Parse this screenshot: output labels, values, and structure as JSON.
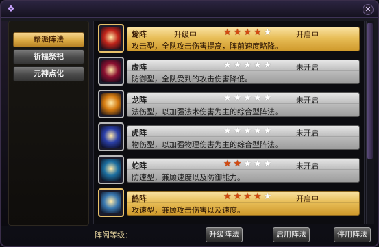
{
  "window": {
    "close_glyph": "✕",
    "corner_glyph": "❖"
  },
  "sidebar": {
    "items": [
      {
        "label": "帮派阵法",
        "active": true
      },
      {
        "label": "祈福祭祀",
        "active": false
      },
      {
        "label": "元神点化",
        "active": false
      }
    ]
  },
  "formations": [
    {
      "name": "鸷阵",
      "progress_label": "升级中",
      "stars": 4,
      "max_stars": 5,
      "state": "开启中",
      "desc": "攻击型，全队攻击伤害提高，阵前速度略降。",
      "active": true,
      "icon": "fire-bird-icon",
      "icon_color": "#c0241a"
    },
    {
      "name": "虚阵",
      "progress_label": "",
      "stars": 0,
      "max_stars": 5,
      "state": "未开启",
      "desc": "防御型，全队受到的攻击伤害降低。",
      "active": false,
      "icon": "demon-icon",
      "icon_color": "#8a1030"
    },
    {
      "name": "龙阵",
      "progress_label": "",
      "stars": 0,
      "max_stars": 5,
      "state": "未开启",
      "desc": "法伤型，以加强法术伤害为主的综合型阵法。",
      "active": false,
      "icon": "dragon-icon",
      "icon_color": "#d47a10"
    },
    {
      "name": "虎阵",
      "progress_label": "",
      "stars": 0,
      "max_stars": 5,
      "state": "未开启",
      "desc": "物伤型，以加强物理伤害为主的综合型阵法。",
      "active": false,
      "icon": "tiger-icon",
      "icon_color": "#2a3fa8"
    },
    {
      "name": "蛇阵",
      "progress_label": "",
      "stars": 2,
      "max_stars": 5,
      "state": "未开启",
      "desc": "防速型，兼顾速度以及防御能力。",
      "active": false,
      "icon": "snake-icon",
      "icon_color": "#1d6fa0"
    },
    {
      "name": "鹤阵",
      "progress_label": "",
      "stars": 4,
      "max_stars": 5,
      "state": "开启中",
      "desc": "攻速型，兼顾攻击伤害以及速度。",
      "active": true,
      "icon": "crane-icon",
      "icon_color": "#3a78b0"
    }
  ],
  "footer": {
    "level_label": "阵阁等级：",
    "upgrade_label": "升级阵法",
    "enable_label": "启用阵法",
    "disable_label": "停用阵法"
  }
}
